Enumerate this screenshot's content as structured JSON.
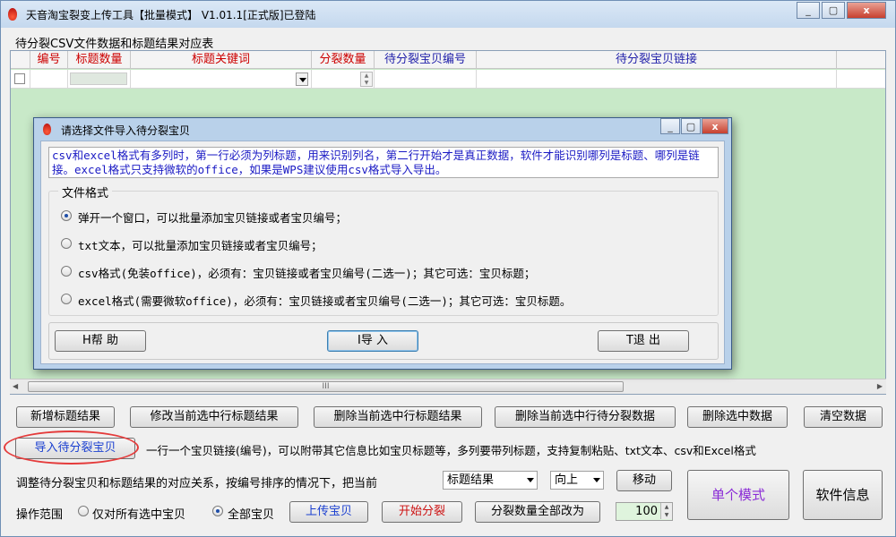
{
  "window": {
    "title": "天音淘宝裂变上传工具【批量模式】 V1.01.1[正式版]已登陆",
    "controls": [
      "_",
      "▢",
      "x"
    ]
  },
  "table": {
    "section_label": "待分裂CSV文件数据和标题结果对应表",
    "columns": [
      "编号",
      "标题数量",
      "标题关键词",
      "分裂数量",
      "待分裂宝贝编号",
      "待分裂宝贝链接"
    ],
    "scroll_thumb_label": "III"
  },
  "dialog": {
    "title": "请选择文件导入待分裂宝贝",
    "note": "csv和excel格式有多列时，第一行必须为列标题，用来识别列名，第二行开始才是真正数据，软件才能识别哪列是标题、哪列是链接。excel格式只支持微软的office，如果是WPS建议使用csv格式导入导出。",
    "group_label": "文件格式",
    "options": [
      "弹开一个窗口，可以批量添加宝贝链接或者宝贝编号；",
      "txt文本，可以批量添加宝贝链接或者宝贝编号；",
      "csv格式(免装office)，必须有：宝贝链接或者宝贝编号(二选一)；其它可选：宝贝标题；",
      "excel格式(需要微软office)，必须有：宝贝链接或者宝贝编号(二选一)；其它可选：宝贝标题。"
    ],
    "selected_option": 0,
    "help_button": "H帮 助",
    "import_button": "I导 入",
    "exit_button": "T退 出"
  },
  "toolbar": {
    "add_title_result": "新增标题结果",
    "edit_current_title": "修改当前选中行标题结果",
    "delete_current_title": "删除当前选中行标题结果",
    "delete_current_split": "删除当前选中行待分裂数据",
    "delete_selected": "删除选中数据",
    "clear_data": "清空数据"
  },
  "import": {
    "button": "导入待分裂宝贝",
    "hint": "一行一个宝贝链接(编号)，可以附带其它信息比如宝贝标题等，多列要带列标题，支持复制粘贴、txt文本、csv和Excel格式"
  },
  "adjust": {
    "label": "调整待分裂宝贝和标题结果的对应关系，按编号排序的情况下，把当前",
    "target_select": "标题结果",
    "direction_select": "向上",
    "move_button": "移动"
  },
  "scope": {
    "label": "操作范围",
    "option_selected_only": "仅对所有选中宝贝",
    "option_all": "全部宝贝",
    "selected": "all",
    "upload_button": "上传宝贝",
    "start_split_button": "开始分裂",
    "set_all_count_button": "分裂数量全部改为",
    "count_value": "100"
  },
  "side": {
    "single_mode_button": "单个模式",
    "software_info_button": "软件信息"
  }
}
